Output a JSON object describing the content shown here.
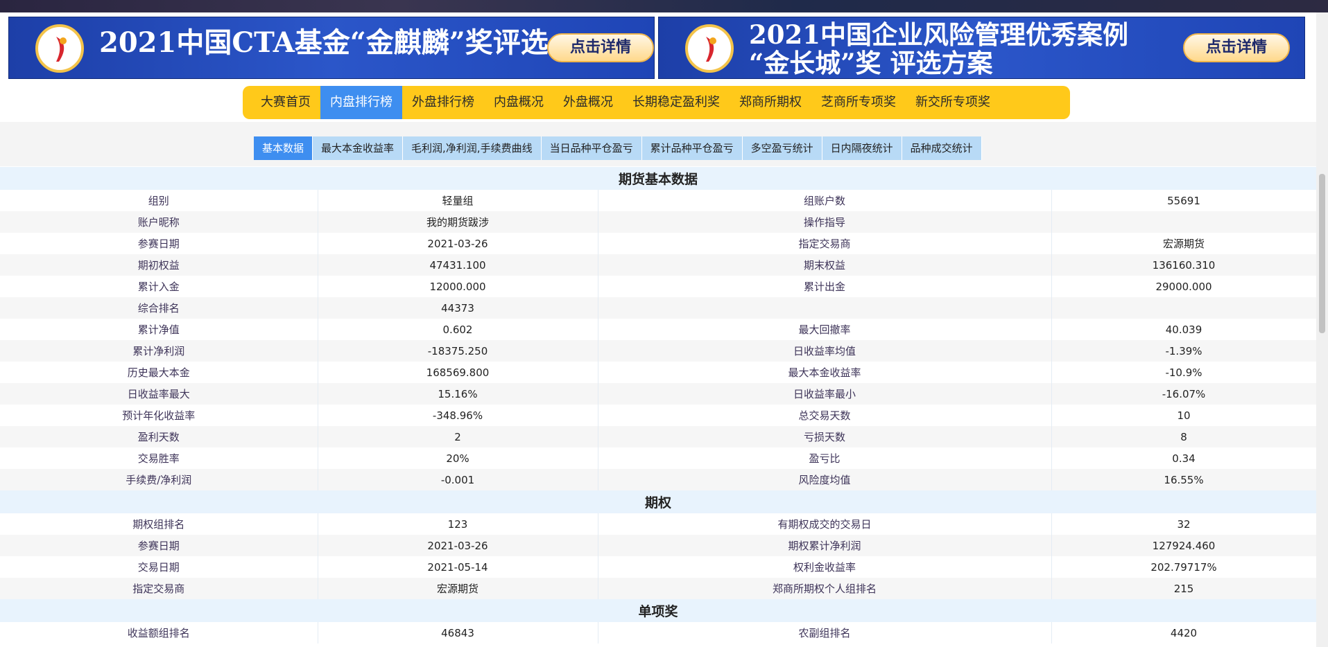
{
  "banners": [
    {
      "title": "2021中国CTA基金“金麒麟”奖评选",
      "button": "点击详情"
    },
    {
      "title_line1": "2021中国企业风险管理优秀案例",
      "title_line2": "“金长城”奖 评选方案",
      "button": "点击详情"
    }
  ],
  "main_nav": {
    "items": [
      "大赛首页",
      "内盘排行榜",
      "外盘排行榜",
      "内盘概况",
      "外盘概况",
      "长期稳定盈利奖",
      "郑商所期权",
      "芝商所专项奖",
      "新交所专项奖"
    ],
    "active": "内盘排行榜"
  },
  "sub_tabs": {
    "items": [
      "基本数据",
      "最大本金收益率",
      "毛利润,净利润,手续费曲线",
      "当日品种平仓盈亏",
      "累计品种平仓盈亏",
      "多空盈亏统计",
      "日内隔夜统计",
      "品种成交统计"
    ],
    "active": "基本数据"
  },
  "sections": {
    "futures": {
      "title": "期货基本数据",
      "rows": [
        [
          "组别",
          "轻量组",
          "组账户数",
          "55691"
        ],
        [
          "账户昵称",
          "我的期货跋涉",
          "操作指导",
          ""
        ],
        [
          "参赛日期",
          "2021-03-26",
          "指定交易商",
          "宏源期货"
        ],
        [
          "期初权益",
          "47431.100",
          "期末权益",
          "136160.310"
        ],
        [
          "累计入金",
          "12000.000",
          "累计出金",
          "29000.000"
        ],
        [
          "综合排名",
          "44373",
          "",
          ""
        ],
        [
          "累计净值",
          "0.602",
          "最大回撤率",
          "40.039"
        ],
        [
          "累计净利润",
          "-18375.250",
          "日收益率均值",
          "-1.39%"
        ],
        [
          "历史最大本金",
          "168569.800",
          "最大本金收益率",
          "-10.9%"
        ],
        [
          "日收益率最大",
          "15.16%",
          "日收益率最小",
          "-16.07%"
        ],
        [
          "预计年化收益率",
          "-348.96%",
          "总交易天数",
          "10"
        ],
        [
          "盈利天数",
          "2",
          "亏损天数",
          "8"
        ],
        [
          "交易胜率",
          "20%",
          "盈亏比",
          "0.34"
        ],
        [
          "手续费/净利润",
          "-0.001",
          "风险度均值",
          "16.55%"
        ]
      ]
    },
    "options": {
      "title": "期权",
      "rows": [
        [
          "期权组排名",
          "123",
          "有期权成交的交易日",
          "32"
        ],
        [
          "参赛日期",
          "2021-03-26",
          "期权累计净利润",
          "127924.460"
        ],
        [
          "交易日期",
          "2021-05-14",
          "权利金收益率",
          "202.79717%"
        ],
        [
          "指定交易商",
          "宏源期货",
          "郑商所期权个人组排名",
          "215"
        ]
      ]
    },
    "awards": {
      "title": "单项奖",
      "rows": [
        [
          "收益额组排名",
          "46843",
          "农副组排名",
          "4420"
        ]
      ]
    }
  },
  "colors": {
    "nav_bg": "#ffc91a",
    "active_blue": "#3e8ef0",
    "subtab_bg": "#b8daf6",
    "section_bg": "#e8f3fd",
    "banner_blue": "#2b56c9"
  }
}
